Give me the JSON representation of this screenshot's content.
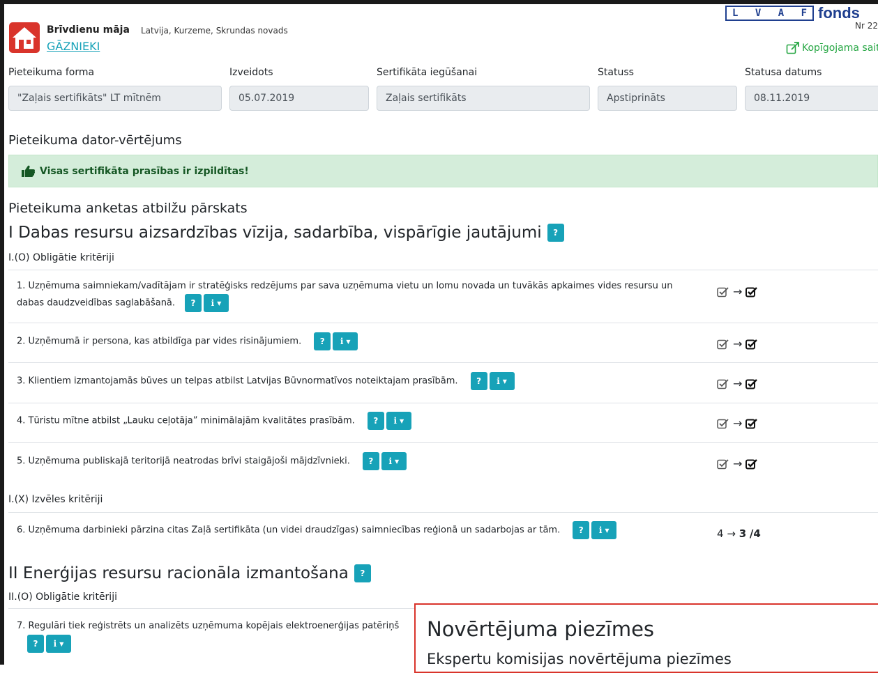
{
  "header": {
    "house_type": "Brīvdienu māja",
    "location": "Latvija, Kurzeme, Skrundas novads",
    "name": "GĀZNIEKI",
    "org_logo_letters": "L V A F",
    "org_logo_word": "fonds",
    "number": "Nr 22",
    "share_label": "Kopīgojama sait",
    "colors": {
      "teal": "#17a2b8",
      "green": "#28a745",
      "logo_red": "#d9342b"
    }
  },
  "form": {
    "application_form_label": "Pieteikuma forma",
    "application_form_value": "\"Zaļais sertifikāts\" LT mītnēm",
    "created_label": "Izveidots",
    "created_value": "05.07.2019",
    "certificate_label": "Sertifikāta iegūšanai",
    "certificate_value": "Zaļais sertifikāts",
    "status_label": "Statuss",
    "status_value": "Apstiprināts",
    "status_date_label": "Statusa datums",
    "status_date_value": "08.11.2019"
  },
  "evaluation": {
    "heading": "Pieteikuma dator-vērtējums",
    "alert": "Visas sertifikāta prasības ir izpildītas!"
  },
  "overview_heading": "Pieteikuma anketas atbilžu pārskats",
  "help_btn": "?",
  "info_btn": "i",
  "arrow": "→",
  "section1": {
    "title": "I Dabas resursu aizsardzības vīzija, sadarbība, vispārīgie jautājumi",
    "mandatory": "I.(O) Obligātie kritēriji",
    "optional": "I.(X) Izvēles kritēriji",
    "q1_line1": "1. Uzņēmuma saimniekam/vadītājam ir stratēģisks redzējums par sava uzņēmuma vietu un lomu novada un tuvākās apkaimes vides resursu un",
    "q1_line2": "dabas daudzveidības saglabāšanā.",
    "q2": "2. Uzņēmumā ir persona, kas atbildīga par vides risinājumiem.",
    "q3": "3. Klientiem izmantojamās būves un telpas atbilst Latvijas Būvnormatīvos noteiktajam prasībām.",
    "q4": "4. Tūristu mītne atbilst „Lauku ceļotāja” minimālajām kvalitātes prasībām.",
    "q5": "5. Uzņēmuma publiskajā teritorijā neatrodas brīvi staigājoši mājdzīvnieki.",
    "q6": "6. Uzņēmuma darbinieki pārzina citas Zaļā sertifikāta (un videi draudzīgas) saimniecības reģionā un sadarbojas ar tām.",
    "q6_self": "4",
    "q6_expert": "3",
    "q6_max": "/4"
  },
  "section2": {
    "title": "II Enerģijas resursu racionāla izmantošana",
    "mandatory": "II.(O) Obligātie kritēriji",
    "q7": "7. Regulāri tiek reģistrēts un analizēts uzņēmuma kopējais elektroenerģijas patēriņš"
  },
  "popup": {
    "title": "Novērtējuma piezīmes",
    "subtitle": "Ekspertu komisijas novērtējuma piezīmes"
  }
}
